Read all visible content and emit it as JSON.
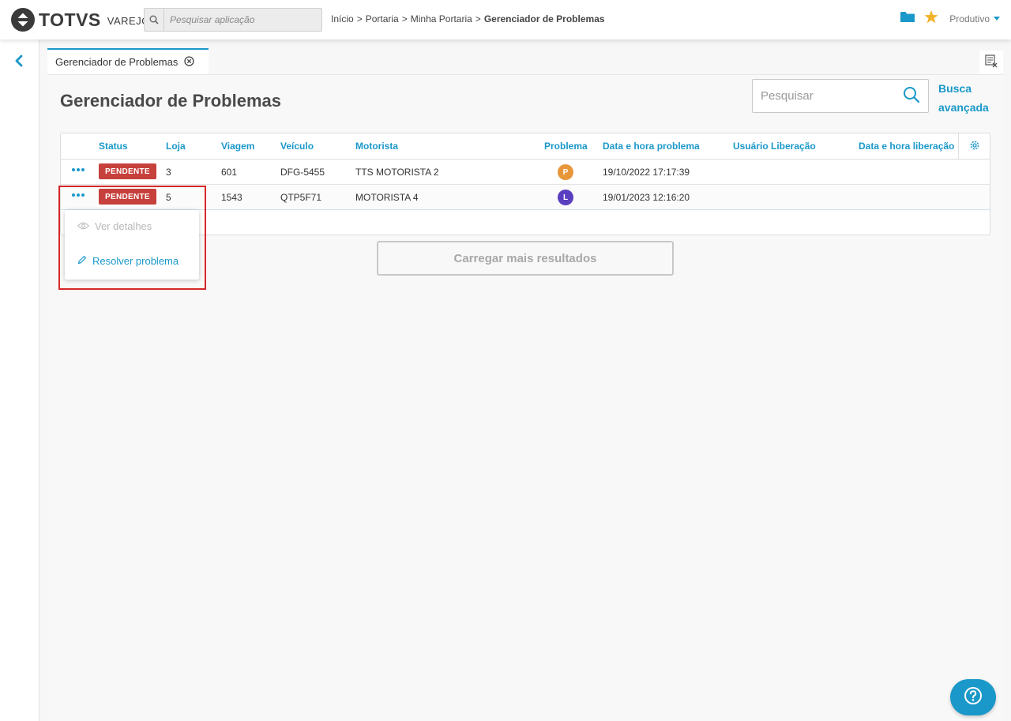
{
  "header": {
    "brand": "TOTVS",
    "brand_sub": "VAREJO",
    "search_placeholder": "Pesquisar aplicação",
    "breadcrumb": [
      {
        "label": "Início"
      },
      {
        "label": "Portaria"
      },
      {
        "label": "Minha Portaria"
      },
      {
        "label": "Gerenciador de Problemas"
      }
    ],
    "environment": "Produtivo",
    "accent_color": "#1a98c9"
  },
  "tab": {
    "label": "Gerenciador de Problemas"
  },
  "page": {
    "title": "Gerenciador de Problemas",
    "search_placeholder": "Pesquisar",
    "advanced_search": "Busca avançada"
  },
  "table": {
    "columns": [
      "Status",
      "Loja",
      "Viagem",
      "Veículo",
      "Motorista",
      "Problema",
      "Data e hora problema",
      "Usuário Liberação",
      "Data e hora liberação"
    ],
    "rows": [
      {
        "status": "PENDENTE",
        "loja": "3",
        "viagem": "601",
        "veiculo": "DFG-5455",
        "motorista": "TTS MOTORISTA 2",
        "problema": "P",
        "problema_color": "#e8963a",
        "data_problema": "19/10/2022 17:17:39",
        "usuario_liberacao": "",
        "data_liberacao": ""
      },
      {
        "status": "PENDENTE",
        "loja": "5",
        "viagem": "1543",
        "veiculo": "QTP5F71",
        "motorista": "MOTORISTA 4",
        "problema": "L",
        "problema_color": "#5a3fc0",
        "data_problema": "19/01/2023 12:16:20",
        "usuario_liberacao": "",
        "data_liberacao": ""
      }
    ],
    "status_color": "#c6403c"
  },
  "menu": {
    "items": [
      {
        "label": "Ver detalhes",
        "disabled": true
      },
      {
        "label": "Resolver problema",
        "disabled": false
      }
    ]
  },
  "load_more": "Carregar mais resultados"
}
